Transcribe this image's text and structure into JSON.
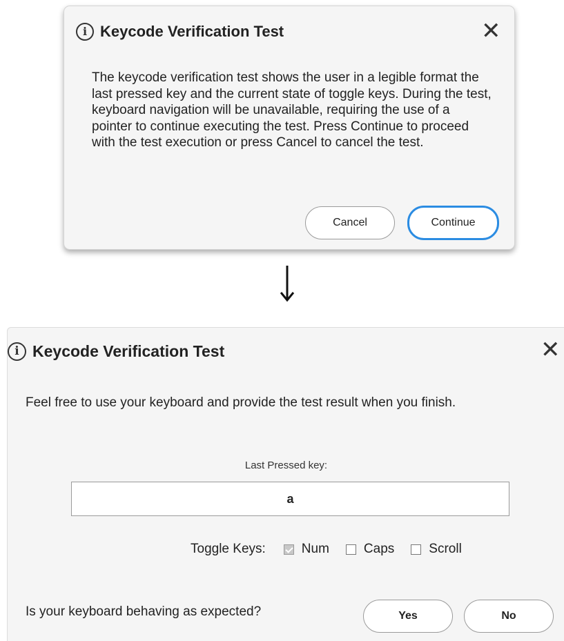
{
  "dialog1": {
    "title": "Keycode Verification Test",
    "info_icon_glyph": "i",
    "close_glyph": "✕",
    "body": "The keycode verification test shows the user in a legible format the last pressed key and the current state of toggle keys. During the test, keyboard navigation will be unavailable, requiring the use of a pointer to continue executing the test. Press Continue to proceed with the test execution or press Cancel to cancel the test.",
    "cancel_label": "Cancel",
    "continue_label": "Continue",
    "focus_color": "#2b8ce2"
  },
  "transition": {
    "icon": "down-arrow-icon"
  },
  "dialog2": {
    "title": "Keycode Verification Test",
    "info_icon_glyph": "i",
    "close_glyph": "✕",
    "intro": "Feel free to use your keyboard and provide the test result when you finish.",
    "last_pressed_label": "Last Pressed key:",
    "last_pressed_value": "a",
    "toggle_label": "Toggle Keys:",
    "toggles": [
      {
        "label": "Num",
        "checked": true
      },
      {
        "label": "Caps",
        "checked": false
      },
      {
        "label": "Scroll",
        "checked": false
      }
    ],
    "question": "Is your keyboard behaving as expected?",
    "yes_label": "Yes",
    "no_label": "No"
  }
}
